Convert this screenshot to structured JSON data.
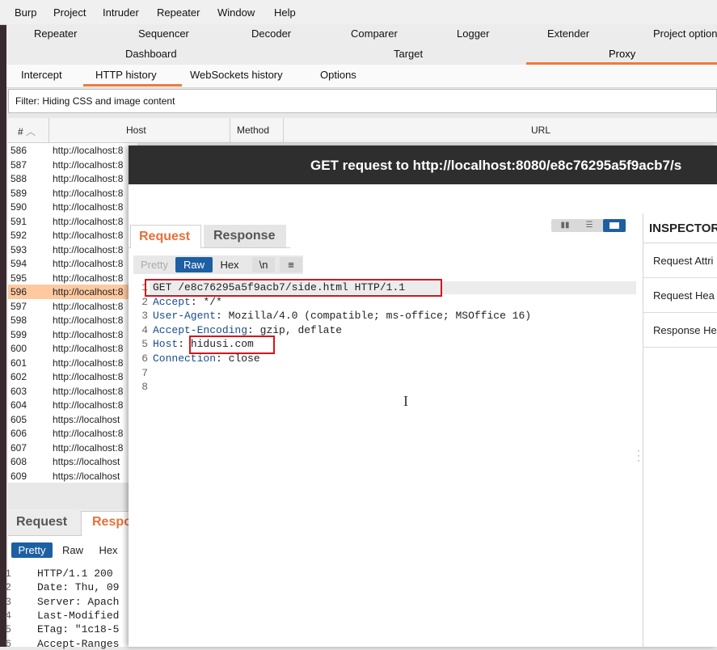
{
  "menu": [
    "Burp",
    "Project",
    "Intruder",
    "Repeater",
    "Window",
    "Help"
  ],
  "tools_row1": [
    "Repeater",
    "Sequencer",
    "Decoder",
    "Comparer",
    "Logger",
    "Extender",
    "Project option"
  ],
  "tools_row2": [
    "Dashboard",
    "Target",
    "Proxy"
  ],
  "proxy_tabs": [
    "Intercept",
    "HTTP history",
    "WebSockets history",
    "Options"
  ],
  "filter": "Filter: Hiding CSS and image content",
  "columns": {
    "num": "#",
    "host": "Host",
    "method": "Method",
    "url": "URL"
  },
  "rows": [
    {
      "n": "586",
      "h": "http://localhost:8"
    },
    {
      "n": "587",
      "h": "http://localhost:8"
    },
    {
      "n": "588",
      "h": "http://localhost:8"
    },
    {
      "n": "589",
      "h": "http://localhost:8"
    },
    {
      "n": "590",
      "h": "http://localhost:8"
    },
    {
      "n": "591",
      "h": "http://localhost:8"
    },
    {
      "n": "592",
      "h": "http://localhost:8"
    },
    {
      "n": "593",
      "h": "http://localhost:8"
    },
    {
      "n": "594",
      "h": "http://localhost:8"
    },
    {
      "n": "595",
      "h": "http://localhost:8"
    },
    {
      "n": "596",
      "h": "http://localhost:8"
    },
    {
      "n": "597",
      "h": "http://localhost:8"
    },
    {
      "n": "598",
      "h": "http://localhost:8"
    },
    {
      "n": "599",
      "h": "http://localhost:8"
    },
    {
      "n": "600",
      "h": "http://localhost:8"
    },
    {
      "n": "601",
      "h": "http://localhost:8"
    },
    {
      "n": "602",
      "h": "http://localhost:8"
    },
    {
      "n": "603",
      "h": "http://localhost:8"
    },
    {
      "n": "604",
      "h": "http://localhost:8"
    },
    {
      "n": "605",
      "h": "https://localhost"
    },
    {
      "n": "606",
      "h": "http://localhost:8"
    },
    {
      "n": "607",
      "h": "http://localhost:8"
    },
    {
      "n": "608",
      "h": "https://localhost"
    },
    {
      "n": "609",
      "h": "https://localhost"
    }
  ],
  "selected_row": "596",
  "bottom": {
    "tab_request": "Request",
    "tab_response": "Respo",
    "btn_pretty": "Pretty",
    "btn_raw": "Raw",
    "btn_hex": "Hex",
    "lines": [
      {
        "n": "1",
        "t": "HTTP/1.1 200"
      },
      {
        "n": "2",
        "t": "Date: Thu, 09"
      },
      {
        "n": "3",
        "t": "Server: Apach"
      },
      {
        "n": "4",
        "t": "Last-Modified"
      },
      {
        "n": "5",
        "t": "ETag: \"1c18-5"
      },
      {
        "n": "6",
        "t": "Accept-Ranges"
      }
    ]
  },
  "dialog": {
    "title": "GET request to http://localhost:8080/e8c76295a5f9acb7/s",
    "tab_request": "Request",
    "tab_response": "Response",
    "btn_pretty": "Pretty",
    "btn_raw": "Raw",
    "btn_hex": "Hex",
    "btn_newline": "\\n",
    "lines": [
      {
        "n": "1",
        "k": "",
        "v": "GET /e8c76295a5f9acb7/side.html HTTP/1.1"
      },
      {
        "n": "2",
        "k": "Accept",
        "v": " */*"
      },
      {
        "n": "3",
        "k": "User-Agent",
        "v": " Mozilla/4.0 (compatible; ms-office; MSOffice 16)"
      },
      {
        "n": "4",
        "k": "Accept-Encoding",
        "v": " gzip, deflate"
      },
      {
        "n": "5",
        "k": "Host",
        "v": " hidusi.com"
      },
      {
        "n": "6",
        "k": "Connection",
        "v": " close"
      },
      {
        "n": "7",
        "k": "",
        "v": ""
      },
      {
        "n": "8",
        "k": "",
        "v": ""
      }
    ],
    "inspector": {
      "title": "INSPECTOR",
      "items": [
        "Request Attri",
        "Request Hea",
        "Response He"
      ]
    }
  },
  "colors": {
    "accent": "#f07a38",
    "blue": "#1a4b8c",
    "highlight": "#d9121a"
  }
}
